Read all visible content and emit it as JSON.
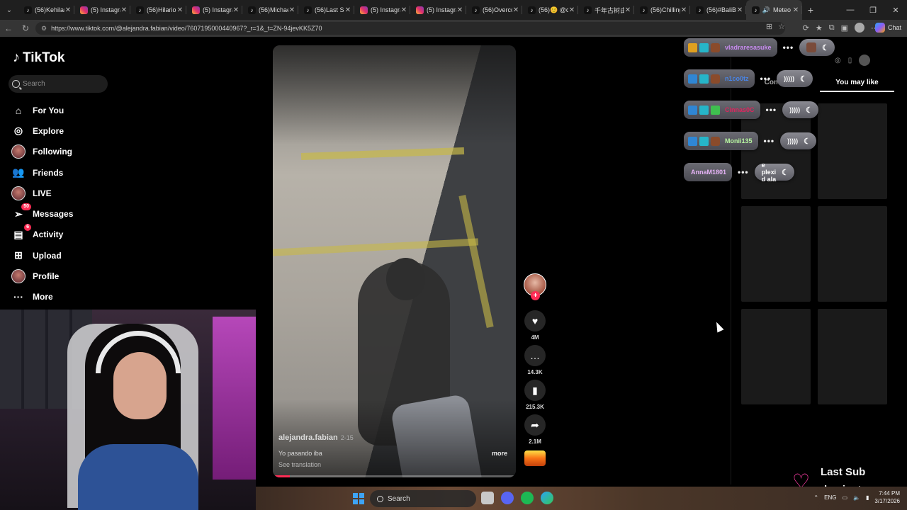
{
  "browser": {
    "tabs": [
      {
        "title": "(56)Kehilan",
        "icon": "tiktok-icon"
      },
      {
        "title": "(5) Instagra",
        "icon": "instagram-icon"
      },
      {
        "title": "(56)Hilariou",
        "icon": "tiktok-icon"
      },
      {
        "title": "(5) Instagra",
        "icon": "instagram-icon"
      },
      {
        "title": "(56)Michae",
        "icon": "tiktok-icon"
      },
      {
        "title": "(56)Last Su",
        "icon": "tiktok-icon"
      },
      {
        "title": "(5) Instagra",
        "icon": "instagram-icon"
      },
      {
        "title": "(5) Instagra",
        "icon": "instagram-icon"
      },
      {
        "title": "(56)Overco",
        "icon": "tiktok-icon"
      },
      {
        "title": "(56)😊 @c",
        "icon": "tiktok-icon"
      },
      {
        "title": "千年古树由",
        "icon": "tiktok-icon"
      },
      {
        "title": "(56)Chilling",
        "icon": "tiktok-icon"
      },
      {
        "title": "(56)#BaliB",
        "icon": "tiktok-icon"
      },
      {
        "title": "Meteo",
        "icon": "speaker-icon",
        "active": true
      }
    ],
    "url": "https://www.tiktok.com/@alejandra.fabian/video/7607195000440967?_r=1&_t=ZN-94jevKK5Z70",
    "chat_label": "Chat"
  },
  "tiktok": {
    "logo": "TikTok",
    "search_placeholder": "Search",
    "nav": [
      {
        "label": "For You",
        "icon": "home-icon"
      },
      {
        "label": "Explore",
        "icon": "compass-icon"
      },
      {
        "label": "Following",
        "icon": "avatar"
      },
      {
        "label": "Friends",
        "icon": "friends-icon"
      },
      {
        "label": "LIVE",
        "icon": "avatar"
      },
      {
        "label": "Messages",
        "icon": "send-icon",
        "badge": "50"
      },
      {
        "label": "Activity",
        "icon": "inbox-icon",
        "badge": "6"
      },
      {
        "label": "Upload",
        "icon": "plus-square-icon"
      },
      {
        "label": "Profile",
        "icon": "avatar"
      },
      {
        "label": "More",
        "icon": "more-icon"
      }
    ],
    "video": {
      "author": "alejandra.fabian",
      "author_meta": "2-15",
      "caption": "Yo pasando iba",
      "see_translation": "See translation",
      "more": "more",
      "progress": 0.07
    },
    "actions": {
      "likes": "4M",
      "comments": "14.3K",
      "saves": "215.3K",
      "shares": "2.1M"
    },
    "right_panel": {
      "tab_comments": "Comments",
      "tab_you_may_like": "You may like",
      "active_tab": "You may like"
    }
  },
  "stream_chat": [
    {
      "user": "vladraresasuke",
      "color": "#c88cf0"
    },
    {
      "user": "n1co0tz",
      "color": "#4a86e8"
    },
    {
      "user": "Cinnas0C",
      "color": "#e0245e"
    },
    {
      "user": "Monii135",
      "color": "#b6f5a0"
    },
    {
      "user": "AnnaM1801",
      "color": "#e6b3f7",
      "message": "e plexi d ala"
    }
  ],
  "last_sub": {
    "title": "Last Sub",
    "name": "damiantg"
  },
  "taskbar": {
    "search": "Search",
    "lang": "ENG",
    "time": "7:44 PM",
    "date": "3/17/2026"
  }
}
